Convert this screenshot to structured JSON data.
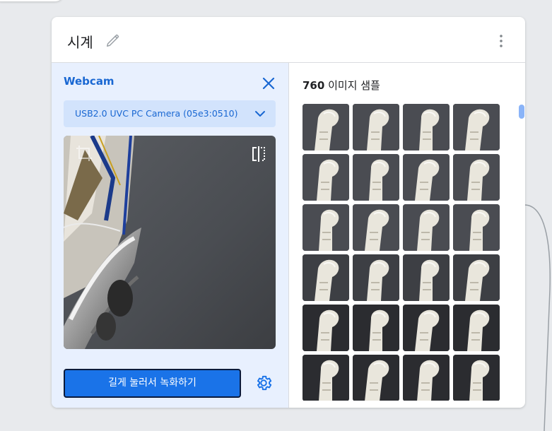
{
  "card": {
    "title": "시계"
  },
  "webcam": {
    "label": "Webcam",
    "camera": "USB2.0 UVC PC Camera (05e3:0510)",
    "record_button": "길게 눌러서 녹화하기"
  },
  "samples": {
    "count": "760",
    "label": " 이미지 샘플",
    "thumbnails": [
      {
        "name": "sample-1"
      },
      {
        "name": "sample-2"
      },
      {
        "name": "sample-3"
      },
      {
        "name": "sample-4"
      },
      {
        "name": "sample-5"
      },
      {
        "name": "sample-6"
      },
      {
        "name": "sample-7"
      },
      {
        "name": "sample-8"
      },
      {
        "name": "sample-9"
      },
      {
        "name": "sample-10"
      },
      {
        "name": "sample-11"
      },
      {
        "name": "sample-12"
      },
      {
        "name": "sample-13"
      },
      {
        "name": "sample-14"
      },
      {
        "name": "sample-15"
      },
      {
        "name": "sample-16"
      },
      {
        "name": "sample-17"
      },
      {
        "name": "sample-18"
      },
      {
        "name": "sample-19"
      },
      {
        "name": "sample-20"
      },
      {
        "name": "sample-21"
      },
      {
        "name": "sample-22"
      },
      {
        "name": "sample-23"
      },
      {
        "name": "sample-24"
      }
    ]
  },
  "icons": {
    "edit": "pencil-icon",
    "more": "more-vert-icon",
    "close": "close-icon",
    "dropdown": "chevron-down-icon",
    "crop": "crop-icon",
    "flip": "flip-icon",
    "settings": "gear-icon"
  },
  "colors": {
    "accent": "#1a73e8",
    "accent_text": "#1967d2",
    "panel_bg": "#e8f0fe",
    "select_bg": "#d2e3fc"
  }
}
